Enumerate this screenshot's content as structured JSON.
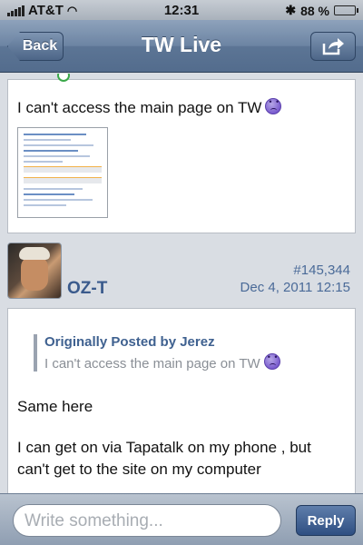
{
  "status_bar": {
    "carrier": "AT&T",
    "time": "12:31",
    "battery": "88 %",
    "battery_level": 0.88
  },
  "nav": {
    "back_label": "Back",
    "title": "TW Live",
    "share_icon": "share-icon"
  },
  "posts": [
    {
      "text": "I can't access the main page on TW",
      "emoticon": "sad-icon",
      "has_attachment_thumbnail": true
    },
    {
      "username": "OZ-T",
      "post_number": "#145,344",
      "date": "Dec 4, 2011 12:15",
      "quote_by": "Originally Posted by Jerez",
      "quote_text": "I can't access the main page on TW",
      "body": [
        "Same here",
        "I can get on via Tapatalk on my phone , but can't get to the site on my computer"
      ]
    }
  ],
  "composer": {
    "placeholder": "Write something...",
    "reply_label": "Reply"
  }
}
